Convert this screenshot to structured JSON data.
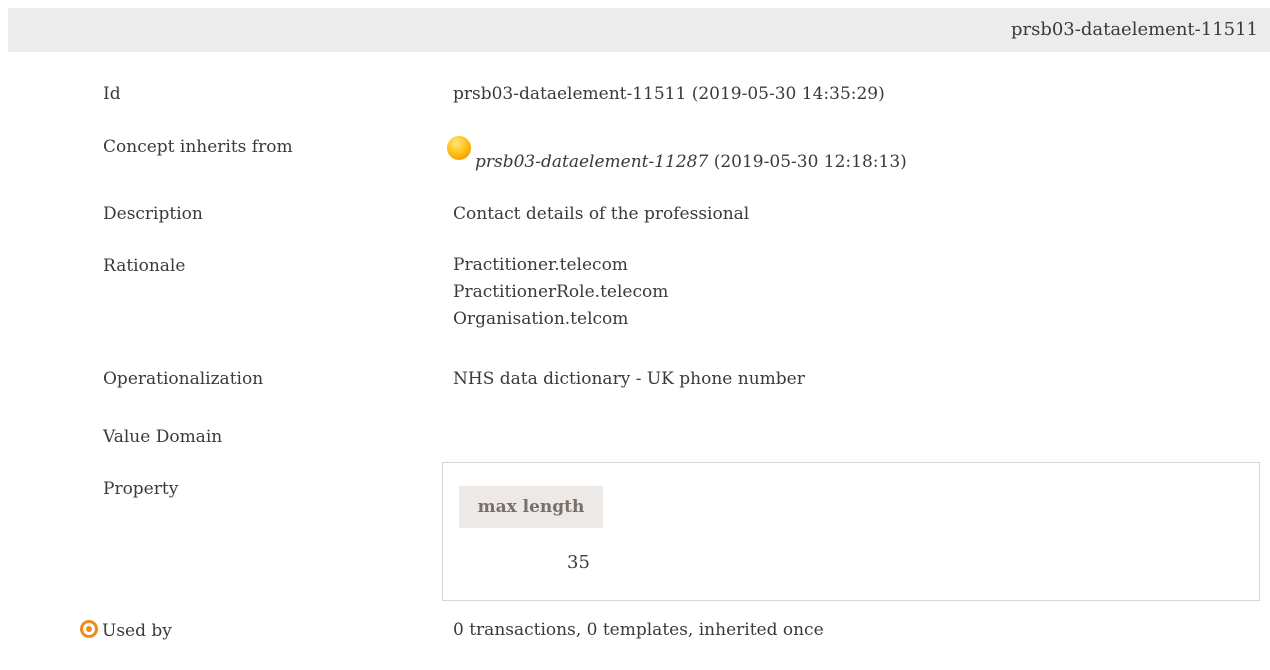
{
  "header": {
    "title": "prsb03-dataelement-11511"
  },
  "rows": {
    "id": {
      "label": "Id",
      "value": "prsb03-dataelement-11511 (2019-05-30 14:35:29)"
    },
    "inherits": {
      "label": "Concept inherits from",
      "ref": "prsb03-dataelement-11287",
      "date": " (2019-05-30 12:18:13)",
      "icon": "concept-orb-icon",
      "icon_color": "#ffc21a"
    },
    "description": {
      "label": "Description",
      "value": "Contact details of the professional"
    },
    "rationale": {
      "label": "Rationale",
      "lines": [
        "Practitioner.telecom",
        "PractitionerRole.telecom",
        "Organisation.telcom"
      ]
    },
    "operationalization": {
      "label": "Operationalization",
      "value": "NHS data dictionary - UK phone number"
    },
    "value_domain": {
      "label": "Value Domain"
    },
    "property": {
      "label": "Property",
      "column_header": "max length",
      "value": "35"
    },
    "used_by": {
      "label": "Used by",
      "icon": "target-icon",
      "icon_color": "#f08a1c",
      "value": "0 transactions, 0 templates, inherited once"
    }
  }
}
